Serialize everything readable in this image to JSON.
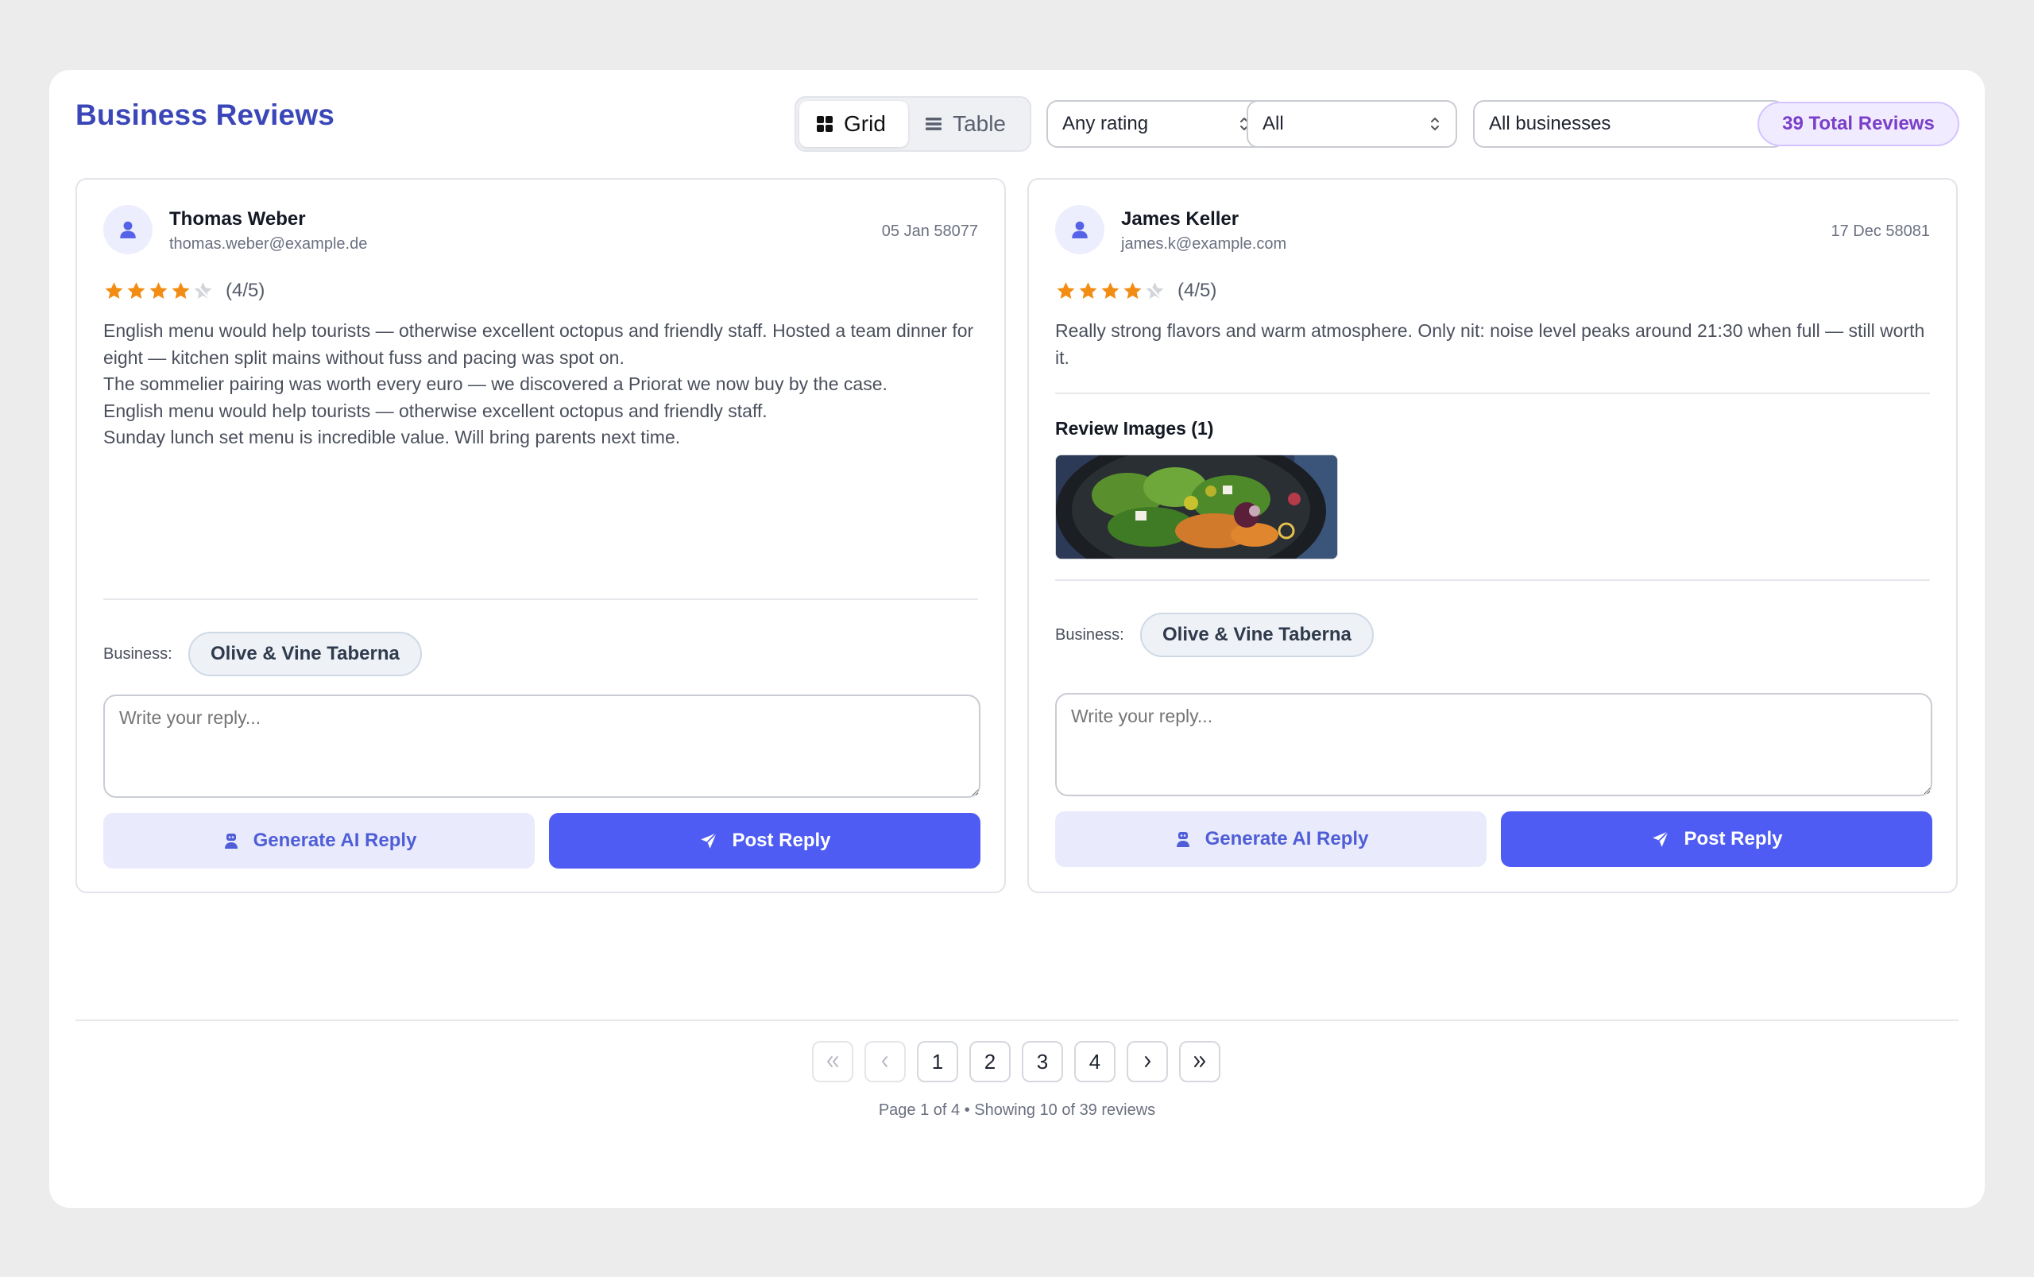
{
  "header": {
    "title": "Business Reviews",
    "view_toggle": {
      "grid_label": "Grid",
      "table_label": "Table",
      "active": "Grid"
    },
    "filters": {
      "rating": "Any rating",
      "status": "All",
      "business": "All businesses"
    },
    "total_badge": "39 Total Reviews"
  },
  "reviews": [
    {
      "name": "Thomas Weber",
      "email": "thomas.weber@example.de",
      "date": "05 Jan 58077",
      "rating": 4,
      "rating_text": "(4/5)",
      "text": [
        "English menu would help tourists — otherwise excellent octopus and friendly staff. Hosted a team dinner for eight — kitchen split mains without fuss and pacing was spot on.",
        "The sommelier pairing was worth every euro — we discovered a Priorat we now buy by the case.",
        "English menu would help tourists — otherwise excellent octopus and friendly staff.",
        "Sunday lunch set menu is incredible value. Will bring parents next time."
      ],
      "business_label": "Business:",
      "business": "Olive & Vine Taberna",
      "reply_placeholder": "Write your reply...",
      "ai_button": "Generate AI Reply",
      "post_button": "Post Reply"
    },
    {
      "name": "James Keller",
      "email": "james.k@example.com",
      "date": "17 Dec 58081",
      "rating": 4,
      "rating_text": "(4/5)",
      "text": [
        "Really strong flavors and warm atmosphere. Only nit: noise level peaks around 21:30 when full — still worth it."
      ],
      "images_title": "Review Images (1)",
      "business_label": "Business:",
      "business": "Olive & Vine Taberna",
      "reply_placeholder": "Write your reply...",
      "ai_button": "Generate AI Reply",
      "post_button": "Post Reply"
    }
  ],
  "pagination": {
    "pages": [
      "1",
      "2",
      "3",
      "4"
    ],
    "current": "1",
    "info": "Page 1 of 4 • Showing 10 of 39 reviews"
  },
  "colors": {
    "accent": "#4e5cf3",
    "title": "#3b47b8",
    "star": "#f28c13",
    "badge": "#7a3fc8"
  },
  "icons": {
    "grid": "grid-icon",
    "table": "list-icon",
    "user": "user-icon",
    "robot": "robot-icon",
    "send": "send-icon"
  }
}
